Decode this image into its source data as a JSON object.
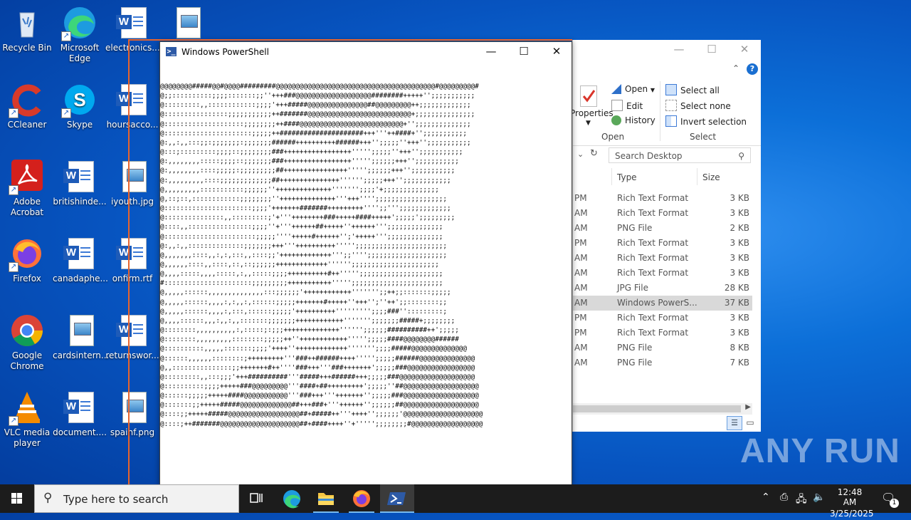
{
  "desktop": {
    "icons": [
      {
        "label": "Recycle Bin",
        "icon": "recycle-bin-icon"
      },
      {
        "label": "Microsoft Edge",
        "icon": "edge-icon"
      },
      {
        "label": "electronics...",
        "icon": "word-doc-icon"
      },
      {
        "label": "",
        "icon": "image-file-icon"
      },
      {
        "label": "CCleaner",
        "icon": "ccleaner-icon"
      },
      {
        "label": "Skype",
        "icon": "skype-icon"
      },
      {
        "label": "hoursacco...",
        "icon": "word-doc-icon"
      },
      {
        "label": "Adobe Acrobat",
        "icon": "acrobat-icon"
      },
      {
        "label": "britishinde...",
        "icon": "word-doc-icon"
      },
      {
        "label": "iyouth.jpg",
        "icon": "image-file-icon"
      },
      {
        "label": "Firefox",
        "icon": "firefox-icon"
      },
      {
        "label": "canadaphe...",
        "icon": "word-doc-icon"
      },
      {
        "label": "onfirm.rtf",
        "icon": "word-doc-icon"
      },
      {
        "label": "Google Chrome",
        "icon": "chrome-icon"
      },
      {
        "label": "cardsintern...",
        "icon": "image-file-icon"
      },
      {
        "label": "returnswor...",
        "icon": "word-doc-icon"
      },
      {
        "label": "VLC media player",
        "icon": "vlc-icon"
      },
      {
        "label": "document....",
        "icon": "word-doc-icon"
      },
      {
        "label": "spainf.png",
        "icon": "image-file-icon"
      }
    ]
  },
  "powershell": {
    "title": "Windows PowerShell",
    "ascii_lines": [
      "@@@@@@@@#####@@#@@@@#########@@@@@@@@@@@@@@@@@@@@@@@@@@@@@@@@@@@@@@@@#@@@@@@@@@#",
      "@;;::::::::::;;;;:::::::;;''+++###@@@@@@@@@@@@@@@@@@@########+++++'';;;;;;;;;;;",
      "@:::::::::,,::::::::::::;;;;'+++#####@@@@@@@@@@@@@@@##@@@@@@@@@++;;;;;;;;;;;;;",
      "@::::::::::::::::;;;;;;;;;;;++#######@@@@@@@@@@@@@@@@@@@@@@@@@@+;;;;;;;;;;;;;;;",
      "@::::::::::::::::::::;;;;;;;;++####@@@@@@@@@@@@@@@@@@@@@@@@@@+'';;;;;;;;;;;;;;",
      "@::::::::::::::::::::::;;;;;++#####################+++'''++####+'';;;;;;;;;;;",
      "@:,,:,,:::;;:;;;;;;;:;;;;;;;######++++++++++######+++'';;;;;''+++'';;;;;;;;;;;",
      "@:::;:::::::::;;;;::;;;;;;;;###+++++++++++++++++''''';;;;;''+++'';;;;;;;;;;;",
      "@:,,,,,,,,:::::;;;;::;;;;;;;###+++++++++++++++++''''';;;;;;+++'';;;;;;;;;;;",
      "@:,,,,,,,,::::;;;;;:;;;;;;;;;##++++++++++++++++''''';;;;;;+++'';;;;;;;;;;;",
      "@:,,,,,,,,,::::;;;;;;;;;;;;;##+++++++++++++++'''''';;;;;+++'';;;;;;;;;;;;",
      "@,,,,,,,,,:::::::::::;;;;;;''++++++++++++++''''''';;;;'+;;;;;;;;;;;;;;",
      "@,::;::,::::::::::::;;;;;;;;''++++++++++++++'''+++'''';;;;;;;;;;;;;;;;;;",
      "@::::::::::::::::::::::;;;;'+++++++#######+++++++++'''';;''';;;;;;;;;;;;;",
      "@:::::::::::::::,,:::::::::;'+'''++++++++###+++++####+++++';;;;;';;;;;;;;;",
      "@::::,,::::::::::::::::;;;;''+'''++++++##+++++''++++++''';;;;;;;;;;;;;;",
      "@:::::::::::::::::::::::;;;;;''''+++++#++++++'';'+++++''';;;;;;;;;;;;;;",
      "@:,,:,,::::::::::::::;;;;;;;+++'''++++++++++''''';;;;;;;;;;;;;;;;;;;;;;;",
      "@,,,,,,,::::,,:,:,:::,,::::;;'+++++++++++++''';;'''';;;;;;;;;;;;;;;;;;;;",
      "@,,,,,,::::,,::::,::,::;;;;;;+++++++++++++'''''';;;;;;;;;;;;;;;;;;;;;;",
      "@,,,,:::::,,,,:::::,:,,:::::;;;;++++++++++#++''''';;;;;;;;;;;;;;;;;;;;;",
      "#::::::::::::::::::::::;;;;;;;;;+++++++++++''''';;;;;;;;;;;;;;;;;;;;;;;",
      "@,,,,,::::::,,,,,,,,,,,,,,:::;;;;;;'++++++++++++''''''';;++;;:::::::;;;;;",
      "@,,,,,::::::,,,,:,:,,:,::::::;;;;;+++++++#+++++''+++'';''++';;::::::::;;",
      "@,,,,,::::::,,,,:,:::,::::::;;;;;'++++++++++''''''''';;;;###'':::::::::;",
      "@,,,,::::::,,,:,,:,,:::::::;;;;;;;++++++++++++''''''';;;;;;;#####+;;;;;;;;",
      "@::::::::,,,,,,,,,,:,:::::;:;;;++++++++++++++'''''';;;;;;##########++';;;;;",
      "@::::::::,,,,,,,,,::::::::;;;;;++''++++++++++++''''';;;;;####@@@@@@@@######",
      "@::::::::::,,,,,:::::::;;;;'++++''+++++++++++++''''''';;;;#####@@@@@@@@@@@@@@",
      "@::::::,,,,,,::::::::;+++++++++'''###++######++++''''';;;;;######@@@@@@@@@@@@@@",
      "@,,:::::::::::::::;;+++++++#++''''###+++'''###+++++++';;;;;###@@@@@@@@@@@@@@@@@",
      "@:::::::::,,:::;;;'+++##########'''#####+++######+++;;;;;###@@@@@@@@@@@@@@@@@@@",
      "@::::::::::;;;;+++++###@@@@@@@@@'''####+##+++++++++';;;;;''##@@@@@@@@@@@@@@@@@@@",
      "@::::::;;;;;+++++####@@@@@@@@@@@'''###+++'''+++++++'';;;;;###@@@@@@@@@@@@@@@@@@@",
      "@:::::::;;+++++#####@@@@@@@@@@@@@##+++###+'''++++++'';;;;;;##@@@@@@@@@@@@@@@@@@@",
      "@::::;;+++++#####@@@@@@@@@@@@@@@@@@##+#####++'''++++'';;;;;;'@@@@@@@@@@@@@@@@@@@@",
      "@::::;++#######@@@@@@@@@@@@@@@@@@@@##+####++++''+''''';;;;;;;;#@@@@@@@@@@@@@@@@@@"
    ]
  },
  "explorer": {
    "ribbon": {
      "properties_label": "Properties",
      "open_label": "Open",
      "edit_label": "Edit",
      "history_label": "History",
      "open_group": "Open",
      "select_all": "Select all",
      "select_none": "Select none",
      "invert_selection": "Invert selection",
      "select_group": "Select"
    },
    "search_placeholder": "Search Desktop",
    "columns": {
      "type": "Type",
      "size": "Size"
    },
    "rows": [
      {
        "time": "PM",
        "type": "Rich Text Format",
        "size": "3 KB"
      },
      {
        "time": "AM",
        "type": "Rich Text Format",
        "size": "3 KB"
      },
      {
        "time": "AM",
        "type": "PNG File",
        "size": "2 KB"
      },
      {
        "time": "PM",
        "type": "Rich Text Format",
        "size": "3 KB"
      },
      {
        "time": "AM",
        "type": "Rich Text Format",
        "size": "3 KB"
      },
      {
        "time": "AM",
        "type": "Rich Text Format",
        "size": "3 KB"
      },
      {
        "time": "AM",
        "type": "JPG File",
        "size": "28 KB"
      },
      {
        "time": "AM",
        "type": "Windows PowerS...",
        "size": "37 KB",
        "selected": true
      },
      {
        "time": "PM",
        "type": "Rich Text Format",
        "size": "3 KB"
      },
      {
        "time": "PM",
        "type": "Rich Text Format",
        "size": "3 KB"
      },
      {
        "time": "AM",
        "type": "PNG File",
        "size": "8 KB"
      },
      {
        "time": "AM",
        "type": "PNG File",
        "size": "7 KB"
      }
    ]
  },
  "taskbar": {
    "search_placeholder": "Type here to search",
    "clock_time": "12:48 AM",
    "clock_date": "3/25/2025",
    "notification_count": "1"
  },
  "watermark": "ANY RUN",
  "colors": {
    "accent": "#0078d7",
    "highlight_border": "#e8642c"
  }
}
